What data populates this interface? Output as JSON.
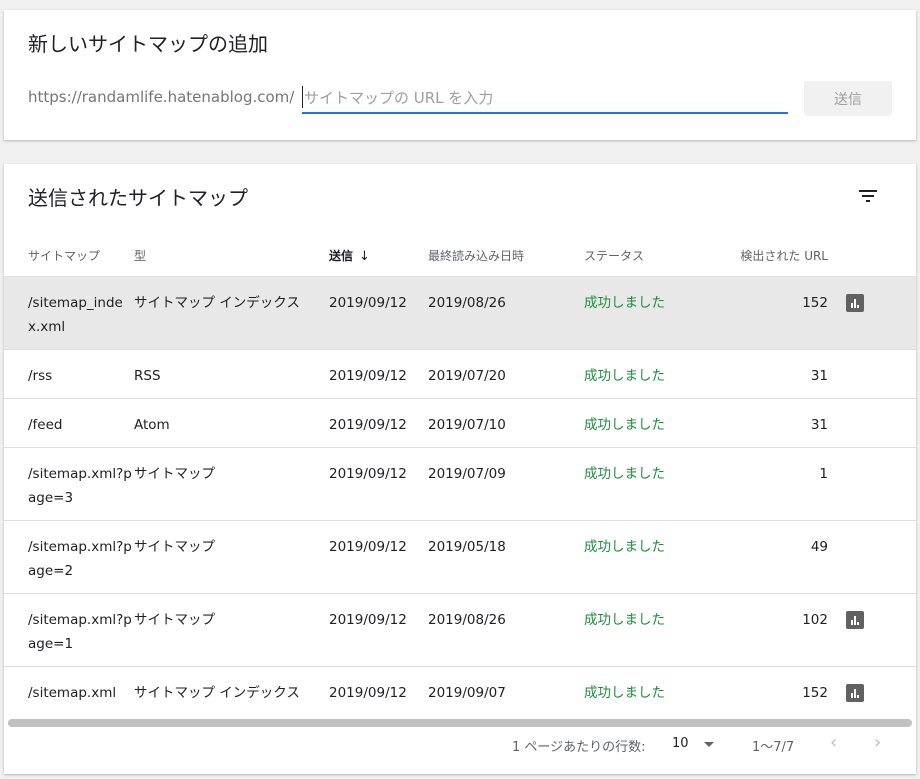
{
  "add_sitemap": {
    "title": "新しいサイトマップの追加",
    "url_prefix": "https://randamlife.hatenablog.com/",
    "input_value": "",
    "input_placeholder": "サイトマップの URL を入力",
    "submit_label": "送信"
  },
  "submitted": {
    "title": "送信されたサイトマップ",
    "columns": {
      "sitemap": "サイトマップ",
      "type": "型",
      "submitted": "送信",
      "last_read": "最終読み込み日時",
      "status": "ステータス",
      "discovered_urls": "検出された URL"
    },
    "sort_arrow": "↓",
    "rows": [
      {
        "sitemap": "/sitemap_index.xml",
        "type": "サイトマップ インデックス",
        "submitted": "2019/09/12",
        "last_read": "2019/08/26",
        "status": "成功しました",
        "urls": "152",
        "chart_icon": "bar-chart-icon"
      },
      {
        "sitemap": "/rss",
        "type": "RSS",
        "submitted": "2019/09/12",
        "last_read": "2019/07/20",
        "status": "成功しました",
        "urls": "31",
        "chart_icon": ""
      },
      {
        "sitemap": "/feed",
        "type": "Atom",
        "submitted": "2019/09/12",
        "last_read": "2019/07/10",
        "status": "成功しました",
        "urls": "31",
        "chart_icon": ""
      },
      {
        "sitemap": "/sitemap.xml?page=3",
        "type": "サイトマップ",
        "submitted": "2019/09/12",
        "last_read": "2019/07/09",
        "status": "成功しました",
        "urls": "1",
        "chart_icon": ""
      },
      {
        "sitemap": "/sitemap.xml?page=2",
        "type": "サイトマップ",
        "submitted": "2019/09/12",
        "last_read": "2019/05/18",
        "status": "成功しました",
        "urls": "49",
        "chart_icon": ""
      },
      {
        "sitemap": "/sitemap.xml?page=1",
        "type": "サイトマップ",
        "submitted": "2019/09/12",
        "last_read": "2019/08/26",
        "status": "成功しました",
        "urls": "102",
        "chart_icon": "bar-chart-icon"
      },
      {
        "sitemap": "/sitemap.xml",
        "type": "サイトマップ インデックス",
        "submitted": "2019/09/12",
        "last_read": "2019/09/07",
        "status": "成功しました",
        "urls": "152",
        "chart_icon": "bar-chart-icon"
      }
    ],
    "selected_row": 0
  },
  "pagination": {
    "rows_per_page_label": "1 ページあたりの行数:",
    "rows_per_page_value": "10",
    "range": "1〜7/7",
    "prev": "‹",
    "next": "›"
  },
  "colors": {
    "status_success": "#1e8e3e",
    "input_focus": "#1a73e8",
    "selected_row": "#e8e8e8"
  }
}
